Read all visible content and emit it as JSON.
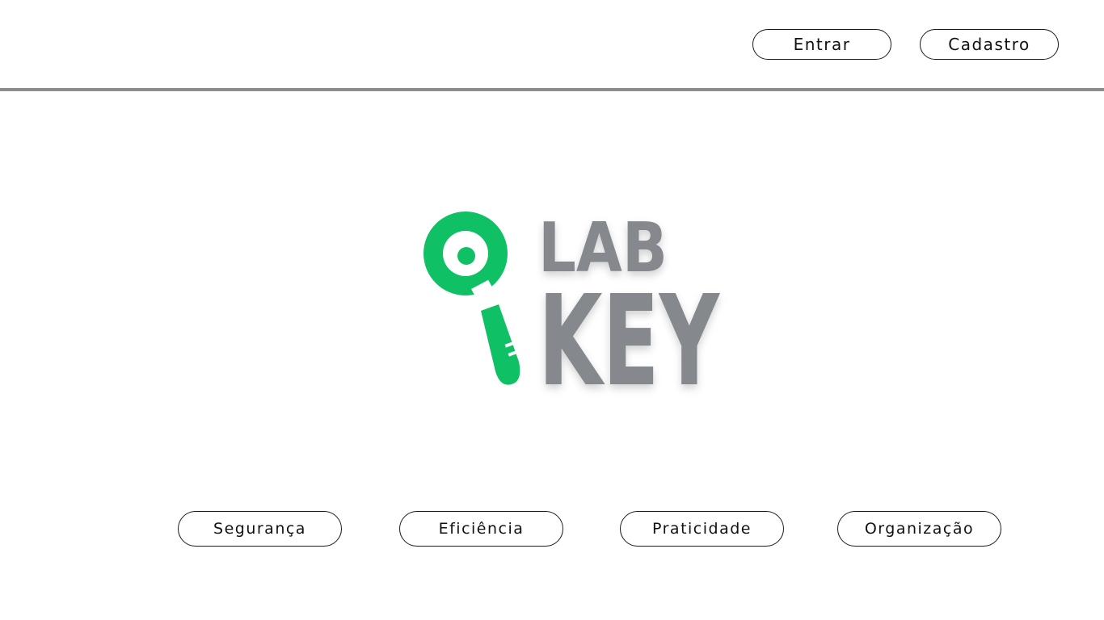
{
  "header": {
    "login_label": "Entrar",
    "signup_label": "Cadastro"
  },
  "logo": {
    "icon": "key-icon",
    "line1": "LAB",
    "line2": "KEY",
    "colors": {
      "key": "#10c065",
      "text": "#85888c"
    }
  },
  "features": [
    {
      "label": "Segurança"
    },
    {
      "label": "Eficiência"
    },
    {
      "label": "Praticidade"
    },
    {
      "label": "Organização"
    }
  ],
  "colors": {
    "divider": "#8a8d90",
    "background": "#ffffff",
    "pill_border": "#1a1a1a"
  }
}
